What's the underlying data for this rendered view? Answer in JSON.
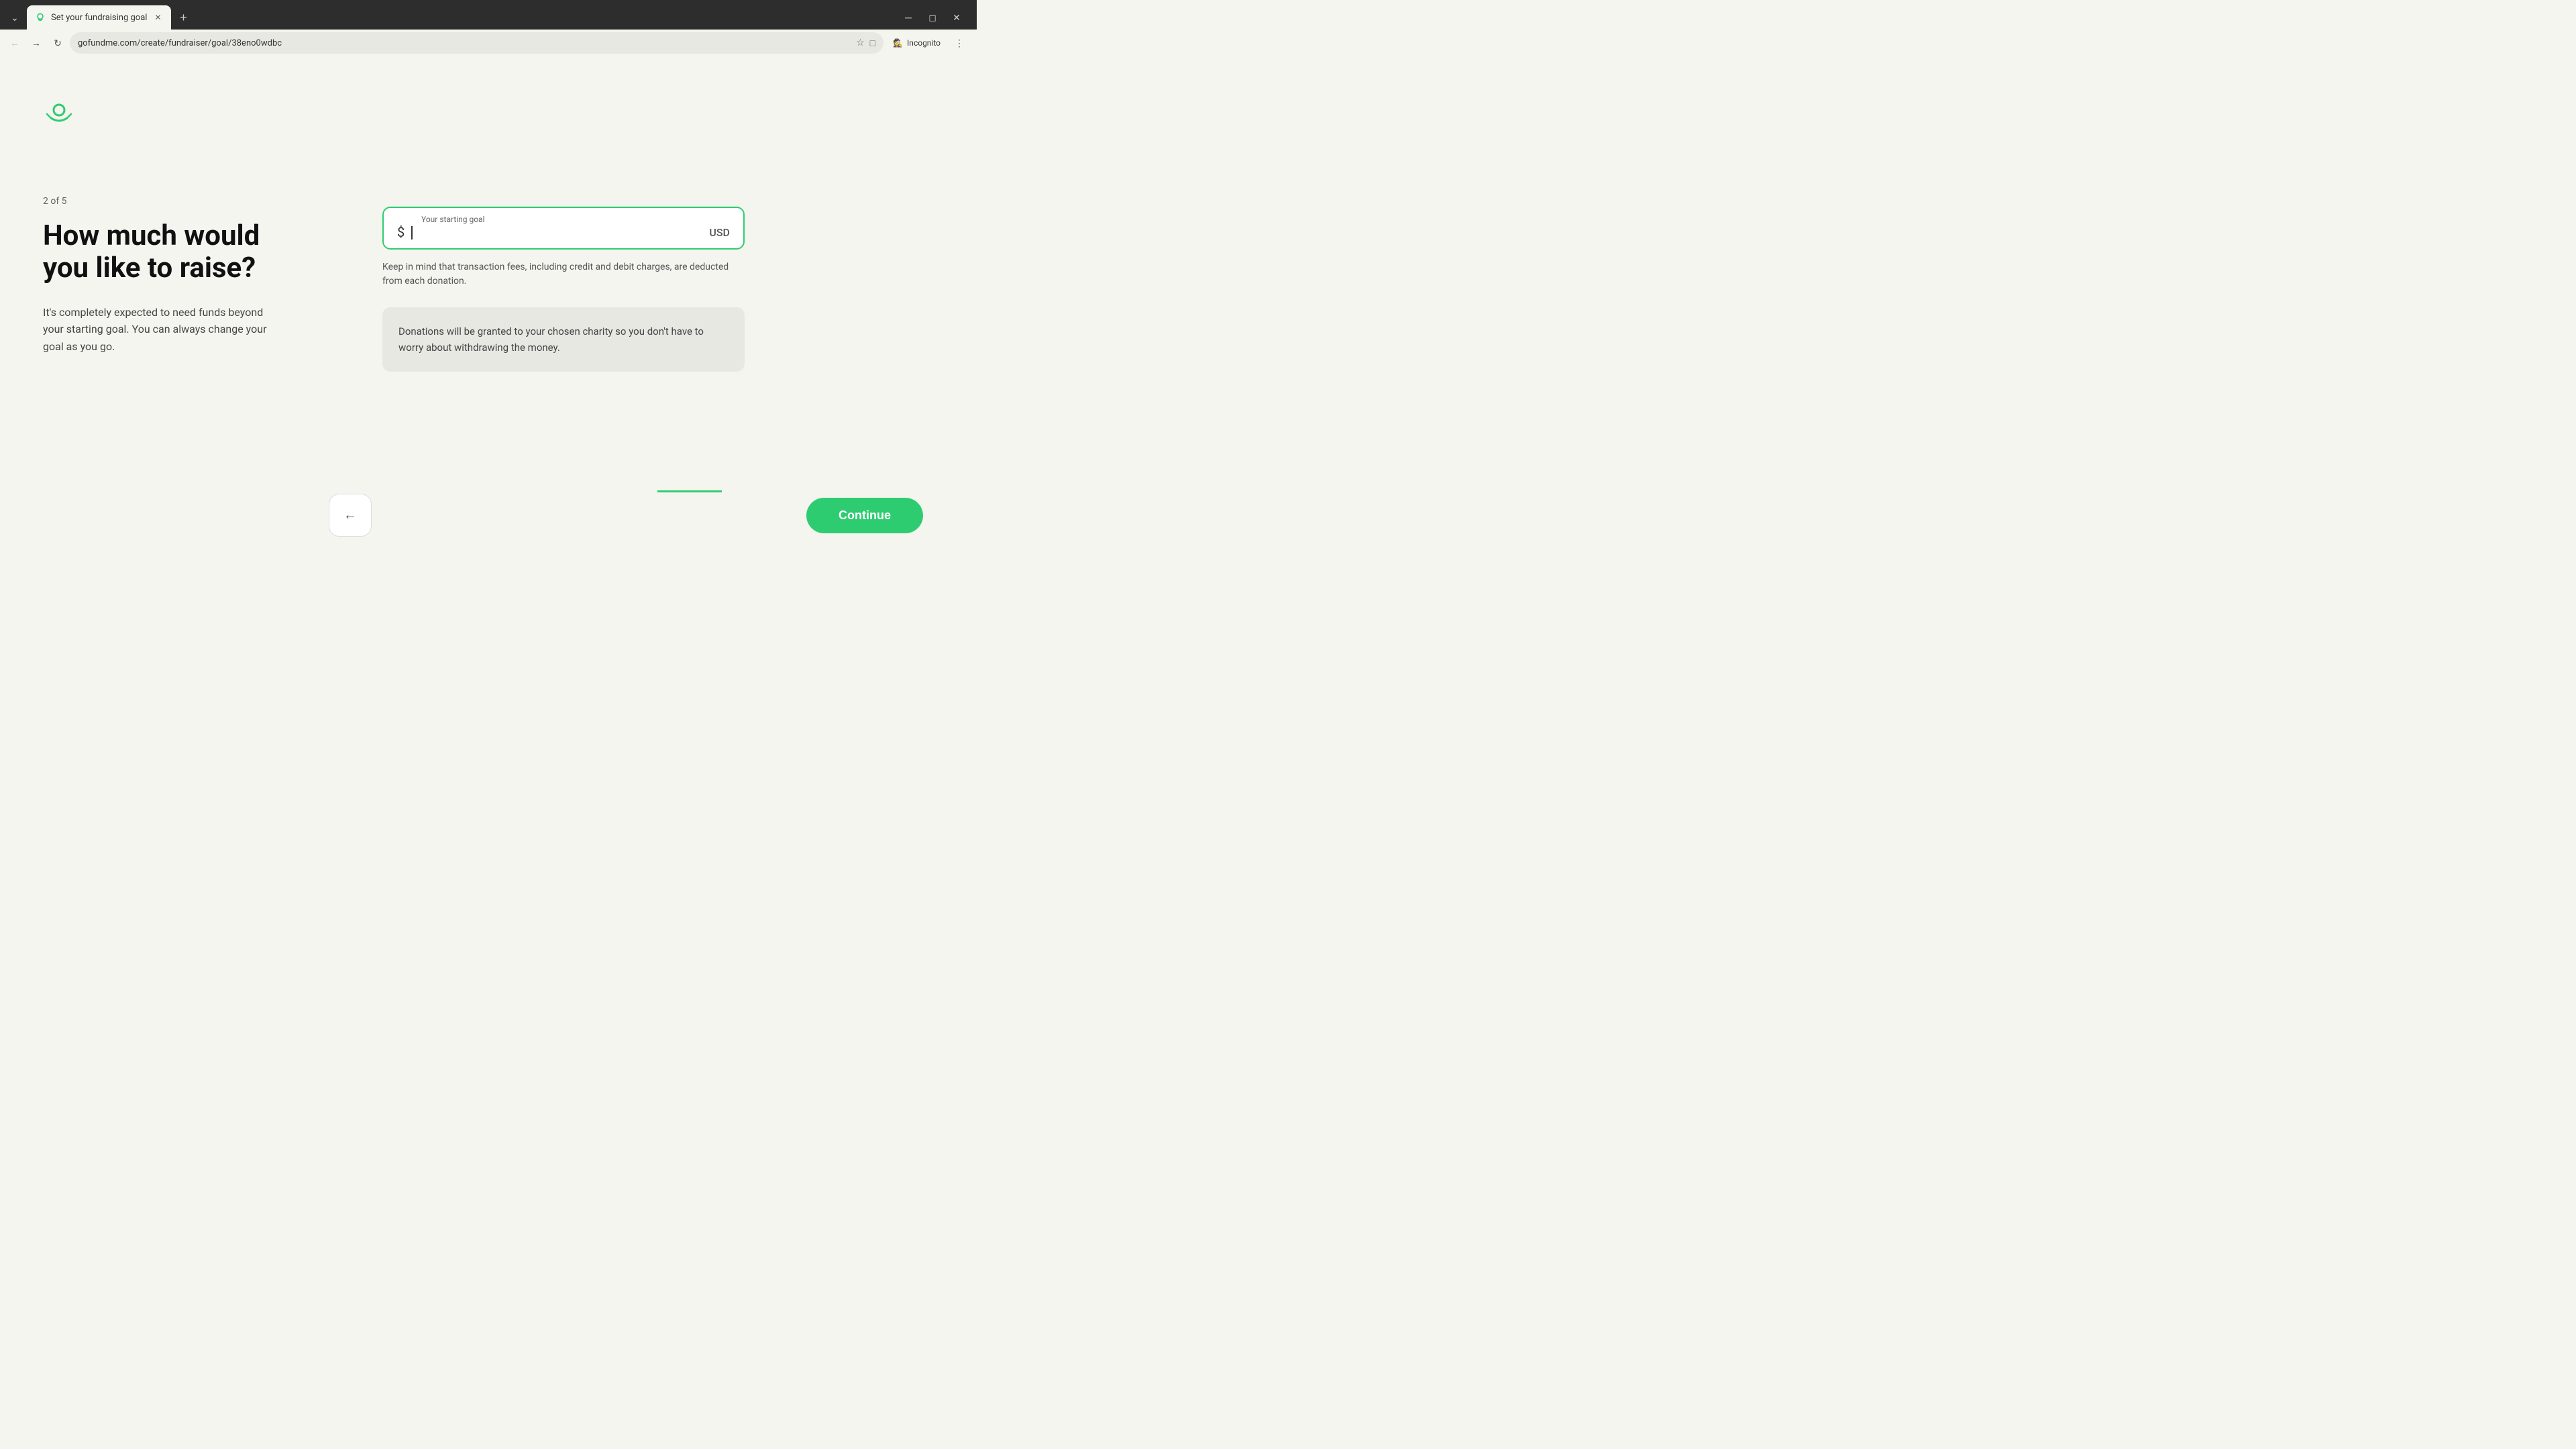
{
  "browser": {
    "tab_title": "Set your fundraising goal",
    "url": "gofundme.com/create/fundraiser/goal/38eno0wdbc",
    "incognito_label": "Incognito"
  },
  "page": {
    "logo_symbol": "☀",
    "step": "2 of 5",
    "heading": "How much would you like to raise?",
    "subtext": "It's completely expected to need funds beyond your starting goal. You can always change your goal as you go.",
    "input": {
      "label": "Your starting goal",
      "dollar_prefix": "$",
      "currency": "USD",
      "value": ""
    },
    "fee_notice": "Keep in mind that transaction fees, including credit and debit charges, are deducted from each donation.",
    "charity_notice": "Donations will be granted to your chosen charity so you don't have to worry about withdrawing the money.",
    "back_arrow": "←",
    "continue_label": "Continue"
  }
}
